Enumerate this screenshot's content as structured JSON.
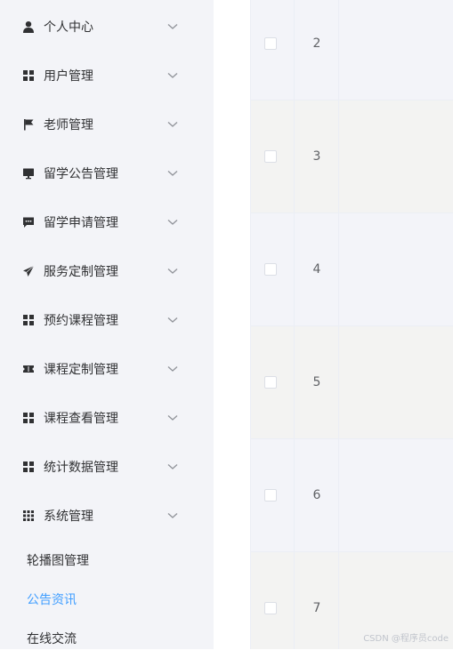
{
  "sidebar": {
    "menu": [
      {
        "label": "个人中心",
        "icon": "user-icon"
      },
      {
        "label": "用户管理",
        "icon": "grid-icon"
      },
      {
        "label": "老师管理",
        "icon": "flag-icon"
      },
      {
        "label": "留学公告管理",
        "icon": "monitor-icon"
      },
      {
        "label": "留学申请管理",
        "icon": "message-icon"
      },
      {
        "label": "服务定制管理",
        "icon": "send-icon"
      },
      {
        "label": "预约课程管理",
        "icon": "grid-icon"
      },
      {
        "label": "课程定制管理",
        "icon": "ticket-icon"
      },
      {
        "label": "课程查看管理",
        "icon": "grid-icon"
      },
      {
        "label": "统计数据管理",
        "icon": "grid-icon"
      },
      {
        "label": "系统管理",
        "icon": "apps-icon"
      }
    ],
    "submenu": [
      {
        "label": "轮播图管理",
        "active": false
      },
      {
        "label": "公告资讯",
        "active": true
      },
      {
        "label": "在线交流",
        "active": false
      }
    ]
  },
  "table": {
    "rows": [
      {
        "index": "2"
      },
      {
        "index": "3"
      },
      {
        "index": "4"
      },
      {
        "index": "5"
      },
      {
        "index": "6"
      },
      {
        "index": "7"
      }
    ]
  },
  "watermark": "CSDN @程序员code",
  "colors": {
    "active": "#409eff",
    "text": "#303133",
    "sidebar_bg": "#f3f4f8"
  }
}
